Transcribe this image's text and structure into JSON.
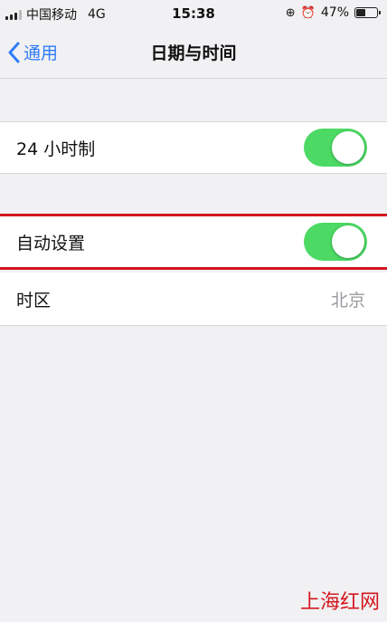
{
  "status_bar": {
    "carrier": "中国移动",
    "network": "4G",
    "time": "15:38",
    "battery_percent": "47%",
    "battery_level": 0.47,
    "icons": [
      "signal-icon",
      "lock-rotation-icon",
      "alarm-icon",
      "battery-icon"
    ]
  },
  "nav": {
    "back_label": "通用",
    "title": "日期与时间"
  },
  "settings": {
    "hour24": {
      "label": "24 小时制",
      "on": true
    },
    "auto_set": {
      "label": "自动设置",
      "on": true
    },
    "timezone": {
      "label": "时区",
      "value": "北京"
    }
  },
  "watermark": "上海红网",
  "colors": {
    "accent": "#2f7cf6",
    "toggle_on": "#4cd964",
    "highlight": "#d4161e",
    "background": "#f1f1f3"
  }
}
